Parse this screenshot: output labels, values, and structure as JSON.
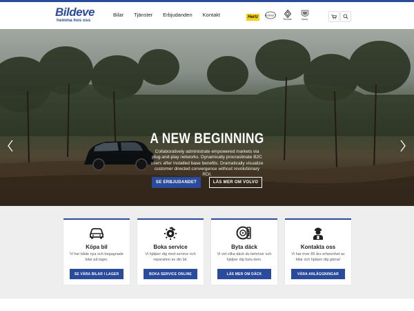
{
  "logo": {
    "name": "Bildeve",
    "tagline": "hemma hos oss"
  },
  "nav": {
    "items": [
      "Bilar",
      "Tjänster",
      "Erbjudanden",
      "Kontakt"
    ]
  },
  "brands": [
    {
      "name": "Hertz",
      "icon": "hertz-logo"
    },
    {
      "name": "Renault",
      "icon": "renault-logo"
    },
    {
      "name": "Renault",
      "icon": "renault-logo"
    },
    {
      "name": "Dacia",
      "icon": "dacia-logo"
    }
  ],
  "header_icons": [
    "cart-icon",
    "search-icon"
  ],
  "hero": {
    "title": "A NEW BEGINNING",
    "text": "Collaboratively administrate empowered markets via plug-and-play networks. Dynamically procrastinate B2C users after installed base benefits. Dramatically visualize customer directed convergence without revolutionary ROI.",
    "primary_button": "SE ERBJUDANDET",
    "secondary_button": "LÄS MER OM VOLVO",
    "slides": 7,
    "active_slide": 1
  },
  "services": [
    {
      "icon": "car-icon",
      "title": "Köpa bil",
      "text": "Vi har både nya och begagnade bilar på lager.",
      "button": "SE VÅRA BILAR I LAGER"
    },
    {
      "icon": "service-icon",
      "title": "Boka service",
      "text": "Vi hjälper dig med service och reparation av din bil.",
      "button": "BOKA SERVICE ONLINE"
    },
    {
      "icon": "tire-icon",
      "title": "Byta däck",
      "text": "Vi vet vilka däck du behöver och hjälper dig byta dem.",
      "button": "LÄS MER OM DÄCK"
    },
    {
      "icon": "mechanic-icon",
      "title": "Kontakta oss",
      "text": "Vi har över 85 års erfarenhet av bilar och hjälper dig gärna!",
      "button": "VÅRA ANLÄGGNINGAR"
    }
  ],
  "colors": {
    "accent": "#2a4b9b",
    "services_bg": "#eeeeee",
    "hertz": "#f7d117"
  }
}
